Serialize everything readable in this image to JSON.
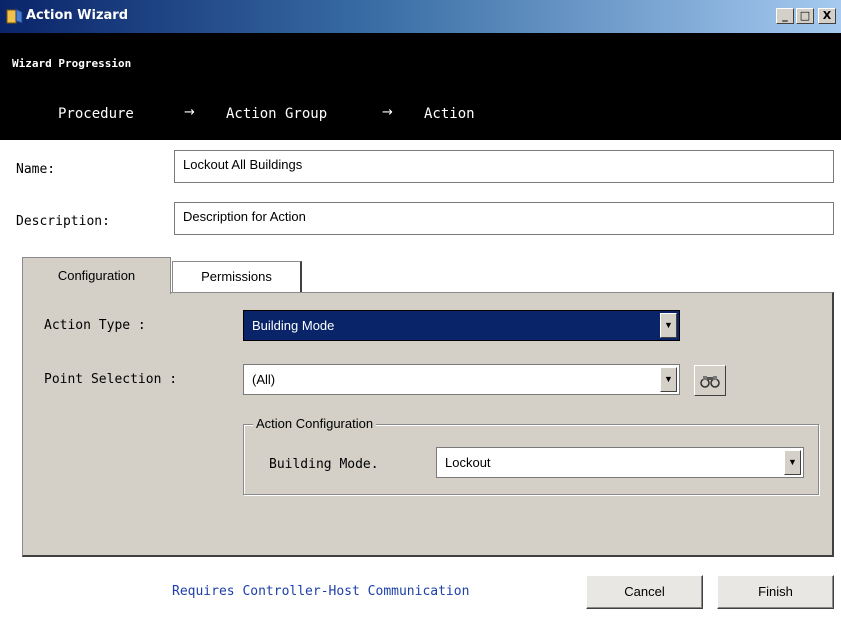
{
  "window": {
    "title": "Action Wizard",
    "controls": {
      "minimize": "_",
      "maximize": "□",
      "close": "X"
    }
  },
  "progression": {
    "title": "Wizard Progression",
    "steps": [
      "Procedure",
      "Action Group",
      "Action"
    ],
    "arrow": "→"
  },
  "form": {
    "name_label": "Name:",
    "name_value": "Lockout All Buildings",
    "description_label": "Description:",
    "description_value": "Description for Action"
  },
  "tabs": {
    "configuration": "Configuration",
    "permissions": "Permissions"
  },
  "configuration": {
    "action_type_label": "Action Type :",
    "action_type_value": "Building Mode",
    "point_selection_label": "Point Selection :",
    "point_selection_value": "(All)",
    "group_title": "Action Configuration",
    "building_mode_label": "Building Mode.",
    "building_mode_value": "Lockout"
  },
  "footer": {
    "note": "Requires Controller-Host Communication",
    "cancel_label": "Cancel",
    "finish_label": "Finish"
  },
  "colors": {
    "titlebar": "#0a246a",
    "progress_band": "#000000",
    "selection": "#0a246a",
    "panel": "#d4d0c8",
    "note_text": "#1d3fa8"
  }
}
